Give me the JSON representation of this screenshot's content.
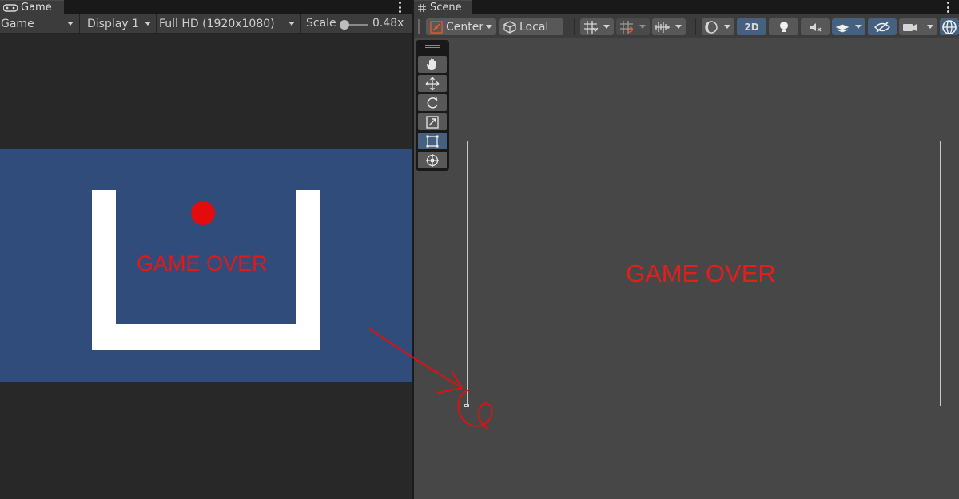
{
  "game_panel": {
    "tab_title": "Game",
    "toolbar": {
      "view_mode": "Game",
      "display": "Display 1",
      "resolution": "Full HD (1920x1080)",
      "scale_label": "Scale",
      "scale_value": "0.48x"
    },
    "view": {
      "background_color": "#304c7a",
      "game_over_text": "GAME OVER",
      "text_color": "#e31818",
      "ball_color": "#e20c0c"
    }
  },
  "scene_panel": {
    "tab_title": "Scene",
    "toolbar": {
      "pivot_mode": "Center",
      "pivot_rotation": "Local",
      "mode_2d": "2D",
      "icons": [
        "grid-snap-icon",
        "snap-increment-icon",
        "audio-visualizer-icon",
        "shading-mode-icon",
        "lighting-icon",
        "audio-mute-icon",
        "effects-icon",
        "hidden-objects-icon",
        "camera-icon",
        "gizmos-icon"
      ]
    },
    "tools": [
      "hand-tool",
      "move-tool",
      "rotate-tool",
      "scale-tool",
      "rect-tool",
      "transform-tool"
    ],
    "active_tool": "rect-tool",
    "view": {
      "game_over_text": "GAME OVER",
      "text_color": "#e51d1d"
    }
  },
  "annotation": {
    "color": "#e01010",
    "description": "hand-drawn arrow pointing to bottom-left corner of the canvas frame"
  }
}
